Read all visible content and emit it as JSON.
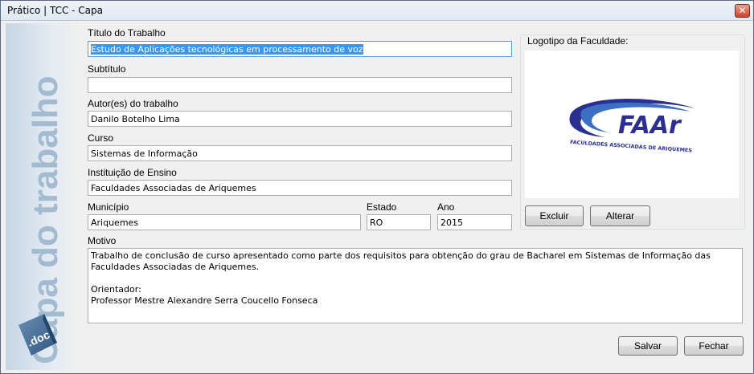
{
  "window": {
    "title": "Prático | TCC - Capa",
    "close_glyph": "✕"
  },
  "sidebar": {
    "banner": "Capa do trabalho",
    "doc_icon_label": ".doc"
  },
  "fields": {
    "titulo": {
      "label": "Título do Trabalho",
      "value": "Estudo de Aplicações tecnológicas em processamento de voz"
    },
    "subtitulo": {
      "label": "Subtítulo",
      "value": ""
    },
    "autores": {
      "label": "Autor(es) do trabalho",
      "value": "Danilo Botelho Lima"
    },
    "curso": {
      "label": "Curso",
      "value": "Sistemas de Informação"
    },
    "instituicao": {
      "label": "Instituição de Ensino",
      "value": "Faculdades Associadas de Ariquemes"
    },
    "municipio": {
      "label": "Município",
      "value": "Ariquemes"
    },
    "estado": {
      "label": "Estado",
      "value": "RO"
    },
    "ano": {
      "label": "Ano",
      "value": "2015"
    },
    "motivo": {
      "label": "Motivo",
      "value": "Trabalho de conclusão de curso apresentado como parte dos requisitos para obtenção do grau de Bacharel em Sistemas de Informação das\nFaculdades Associadas de Ariquemes.\n\nOrientador:\nProfessor Mestre Alexandre Serra Coucello Fonseca"
    }
  },
  "logo": {
    "group_label": "Logotipo da Faculdade:",
    "brand_text": "FAAr",
    "tagline": "FACULDADES ASSOCIADAS DE ARIQUEMES",
    "colors": {
      "primary": "#2b2f8f",
      "accent": "#3a6fc4"
    }
  },
  "buttons": {
    "excluir": "Excluir",
    "alterar": "Alterar",
    "salvar": "Salvar",
    "fechar": "Fechar"
  }
}
